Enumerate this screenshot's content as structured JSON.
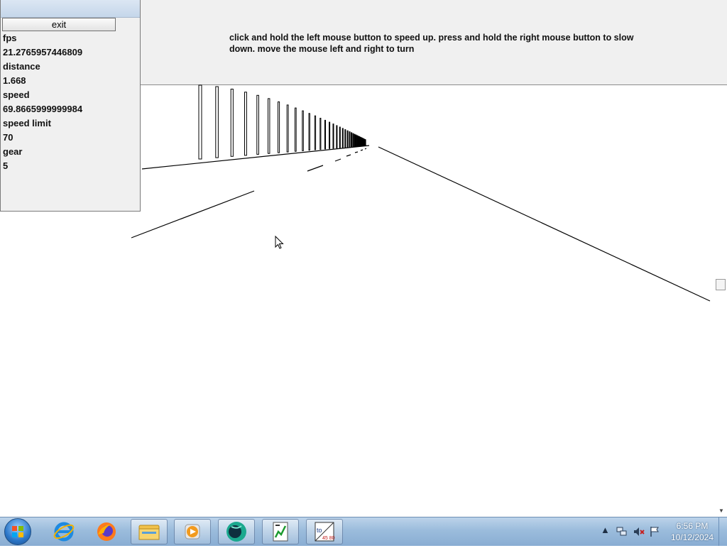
{
  "instructions": "click and hold the left mouse button to speed up. press and hold the right mouse button to slow down. move the mouse left and right to turn",
  "panel": {
    "exit_label": "exit",
    "stats": [
      {
        "label": "fps",
        "value": "21.2765957446809"
      },
      {
        "label": "distance",
        "value": "1.668"
      },
      {
        "label": "speed",
        "value": "69.8665999999984"
      },
      {
        "label": "speed limit",
        "value": "70"
      },
      {
        "label": "gear",
        "value": "5"
      }
    ]
  },
  "taskbar": {
    "items": [
      {
        "name": "start-button-icon"
      },
      {
        "name": "internet-explorer-icon"
      },
      {
        "name": "firefox-icon"
      },
      {
        "name": "file-explorer-icon"
      },
      {
        "name": "media-player-icon"
      },
      {
        "name": "globe-app-icon"
      },
      {
        "name": "notepad-chart-icon"
      },
      {
        "name": "speed-app-icon"
      }
    ],
    "time": "6:56 PM",
    "date": "10/12/2024"
  }
}
